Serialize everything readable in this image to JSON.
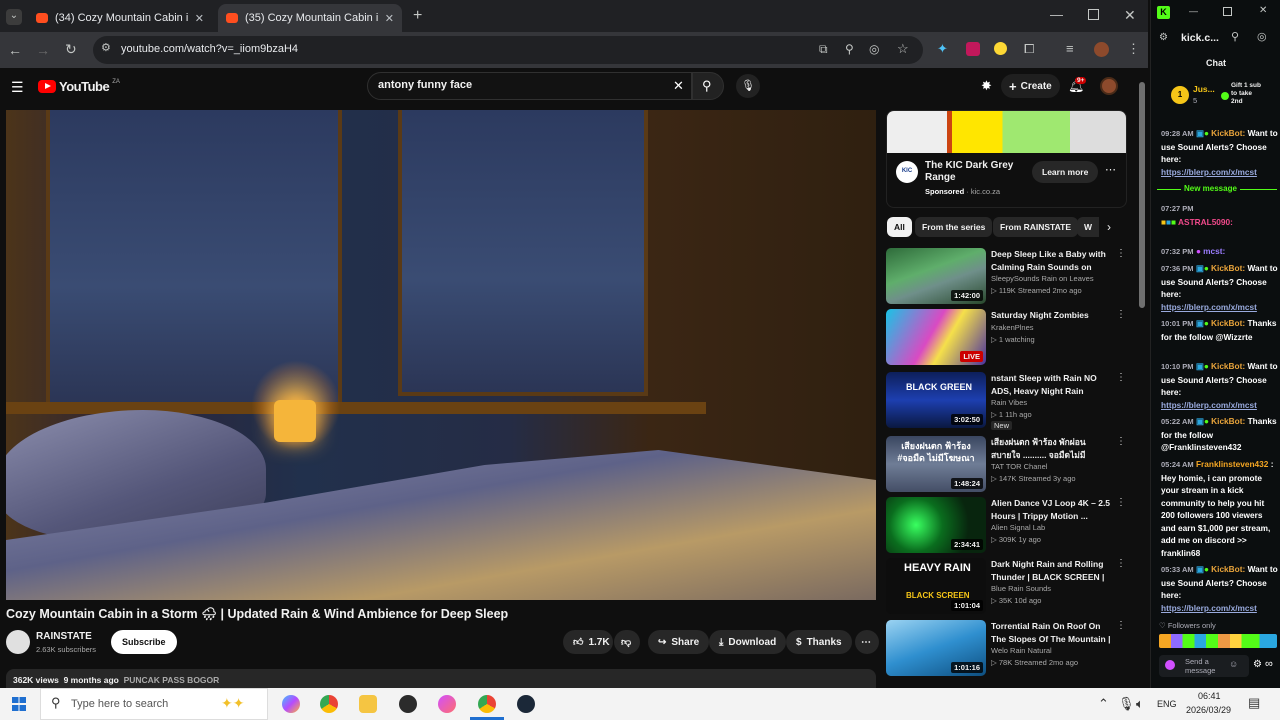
{
  "browser": {
    "tabs": [
      {
        "title": "(34) Cozy Mountain Cabin i"
      },
      {
        "title": "(35) Cozy Mountain Cabin i"
      }
    ],
    "url": "youtube.com/watch?v=_iiom9bzaH4"
  },
  "youtube": {
    "logo": "YouTube",
    "country": "ZA",
    "search_value": "antony funny face",
    "create_label": "Create",
    "notif_count": "9+"
  },
  "video": {
    "title": "Cozy Mountain Cabin in a Storm 🌧 | Updated Rain & Wind Ambience for Deep Sleep",
    "channel": "RAINSTATE",
    "subscribers": "2.63K subscribers",
    "subscribe_label": "Subscribe",
    "likes": "1.7K",
    "share_label": "Share",
    "download_label": "Download",
    "thanks_label": "Thanks",
    "views": "362K views",
    "age": "9 months ago",
    "location": "PUNCAK PASS BOGOR"
  },
  "ad": {
    "title": "The KIC Dark Grey Range",
    "sponsored": "Sponsored",
    "domain": "kic.co.za",
    "cta": "Learn more"
  },
  "chips": [
    "All",
    "From the series",
    "From RAINSTATE",
    "W"
  ],
  "recommendations": [
    {
      "title": "Deep Sleep Like a Baby with Calming Rain Sounds on Fores...",
      "channel": "SleepySounds Rain on Leaves",
      "meta": "▷ 119K  Streamed 2mo ago",
      "duration": "1:42:00",
      "badge": ""
    },
    {
      "title": "Saturday Night Zombies",
      "channel": "KrakenPlnes",
      "meta": "▷ 1 watching",
      "duration": "LIVE",
      "badge": ""
    },
    {
      "title": "nstant Sleep with Rain NO ADS, Heavy Night Rain Sounds ...",
      "channel": "Rain Vibes",
      "meta": "▷ 1  11h ago",
      "duration": "3:02:50",
      "badge": "New"
    },
    {
      "title": "เสียงฝนตก ฟ้าร้อง พักผ่อน สบายใจ .......... จอมืดไม่มีโฆษณา",
      "channel": "TAT TOR Chanel",
      "meta": "▷ 147K  Streamed 3y ago",
      "duration": "1:48:24",
      "badge": ""
    },
    {
      "title": "Alien Dance VJ Loop 4K – 2.5 Hours | Trippy Motion ...",
      "channel": "Alien Signal Lab",
      "meta": "▷ 309K  1y ago",
      "duration": "2:34:41",
      "badge": ""
    },
    {
      "title": "Dark Night Rain and Rolling Thunder | BLACK SCREEN | Re...",
      "channel": "Blue Rain Sounds",
      "meta": "▷ 35K  10d ago",
      "duration": "1:01:04",
      "badge": ""
    },
    {
      "title": "Torrential Rain On Roof On The Slopes Of The Mountain | ...",
      "channel": "Welo Rain Natural",
      "meta": "▷ 78K  Streamed 2mo ago",
      "duration": "1:01:16",
      "badge": ""
    }
  ],
  "thumb_texts": {
    "black_green": "BLACK GREEN",
    "thai": "เสียงฝนตก ฟ้าร้อง #จอมืด ไม่มีโฆษณา",
    "heavy_rain": "HEAVY RAIN",
    "black_screen": "BLACK SCREEN"
  },
  "chat": {
    "site": "kick.c...",
    "header": "Chat",
    "pinned_user": "Jus...",
    "pinned_count": "5",
    "gift_text": "Gift 1 sub to take 2nd",
    "new_message": "New message",
    "followers_only": "Followers only",
    "send_placeholder": "Send a message",
    "messages": [
      {
        "time": "09:28 AM",
        "user": "KickBot:",
        "text": "Want to use Sound Alerts? Choose here:",
        "link": "https://blerp.com/x/mcst"
      },
      {
        "time": "07:27 PM",
        "user": "ASTRAL5090:",
        "text": "",
        "link": ""
      },
      {
        "time": "07:32 PM",
        "user": "mcst:",
        "text": "",
        "link": ""
      },
      {
        "time": "07:36 PM",
        "user": "KickBot:",
        "text": "Want to use Sound Alerts? Choose here:",
        "link": "https://blerp.com/x/mcst"
      },
      {
        "time": "10:01 PM",
        "user": "KickBot:",
        "text": "Thanks for the follow @Wizzrte",
        "link": ""
      },
      {
        "time": "10:10 PM",
        "user": "KickBot:",
        "text": "Want to use Sound Alerts? Choose here:",
        "link": "https://blerp.com/x/mcst"
      },
      {
        "time": "05:22 AM",
        "user": "KickBot:",
        "text": "Thanks for the follow @Franklinsteven432",
        "link": ""
      },
      {
        "time": "05:24 AM",
        "user": "Franklinsteven432",
        "text": ": Hey homie, i can promote your stream in a kick community to help you hit 200 followers 100 viewers and earn $1,000 per stream, add me on discord >> franklin68",
        "link": ""
      },
      {
        "time": "05:33 AM",
        "user": "KickBot:",
        "text": "Want to use Sound Alerts? Choose here:",
        "link": "https://blerp.com/x/mcst"
      }
    ]
  },
  "taskbar": {
    "search_placeholder": "Type here to search",
    "lang": "ENG",
    "time": "06:41",
    "date": "2026/03/29"
  },
  "colors": {
    "yt_red": "#ff0000",
    "kick_green": "#53fc18",
    "bot_orange": "#e9a43b"
  }
}
